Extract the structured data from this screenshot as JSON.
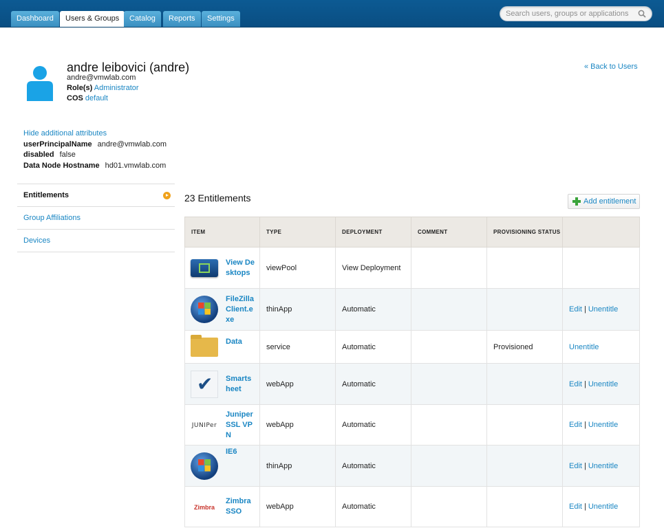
{
  "nav": {
    "tabs": [
      {
        "label": "Dashboard"
      },
      {
        "label": "Users & Groups"
      },
      {
        "label": "Catalog"
      },
      {
        "label": "Reports"
      },
      {
        "label": "Settings"
      }
    ],
    "active_tab": "Users & Groups",
    "search_placeholder": "Search users, groups or applications"
  },
  "user": {
    "name": "andre leibovici (andre)",
    "email": "andre@vmwlab.com",
    "role_label": "Role(s)",
    "role_value": "Administrator",
    "cos_label": "COS",
    "cos_value": "default",
    "back_link": "« Back to Users"
  },
  "attributes": {
    "toggle_link": "Hide additional attributes",
    "items": [
      {
        "key": "userPrincipalName",
        "value": "andre@vmwlab.com"
      },
      {
        "key": "disabled",
        "value": "false"
      },
      {
        "key": "Data Node Hostname",
        "value": "hd01.vmwlab.com"
      }
    ]
  },
  "sidenav": {
    "items": [
      {
        "label": "Entitlements"
      },
      {
        "label": "Group Affiliations"
      },
      {
        "label": "Devices"
      }
    ]
  },
  "entitlements": {
    "title": "23 Entitlements",
    "add_button": "Add entitlement",
    "columns": [
      "ITEM",
      "TYPE",
      "DEPLOYMENT",
      "COMMENT",
      "PROVISIONING STATUS",
      ""
    ],
    "edit_label": "Edit",
    "unentitle_label": "Unentitle",
    "rows": [
      {
        "icon": "view-desktop-icon",
        "name": "View Desktops",
        "type": "viewPool",
        "deployment": "View Deployment",
        "comment": "",
        "status": "",
        "actions": "none"
      },
      {
        "icon": "windows-icon",
        "name": "FileZilla Client.exe",
        "type": "thinApp",
        "deployment": "Automatic",
        "comment": "",
        "status": "",
        "actions": "edit-unentitle"
      },
      {
        "icon": "folder-icon",
        "name": "Data",
        "type": "service",
        "deployment": "Automatic",
        "comment": "",
        "status": "Provisioned",
        "actions": "unentitle"
      },
      {
        "icon": "smartsheet-icon",
        "name": "Smartsheet",
        "type": "webApp",
        "deployment": "Automatic",
        "comment": "",
        "status": "",
        "actions": "edit-unentitle"
      },
      {
        "icon": "juniper-logo",
        "icon_text": "JUNIPer",
        "name": "Juniper SSL VPN",
        "type": "webApp",
        "deployment": "Automatic",
        "comment": "",
        "status": "",
        "actions": "edit-unentitle"
      },
      {
        "icon": "windows-icon",
        "name": "IE6",
        "type": "thinApp",
        "deployment": "Automatic",
        "comment": "",
        "status": "",
        "actions": "edit-unentitle"
      },
      {
        "icon": "zimbra-logo",
        "icon_text": "Zimbra",
        "name": "Zimbra SSO",
        "type": "webApp",
        "deployment": "Automatic",
        "comment": "",
        "status": "",
        "actions": "edit-unentitle"
      }
    ]
  },
  "colors": {
    "topbar": "#0c5a93",
    "link": "#1a86c3",
    "accent_orange": "#f0a21c",
    "add_green": "#3aa33a"
  }
}
